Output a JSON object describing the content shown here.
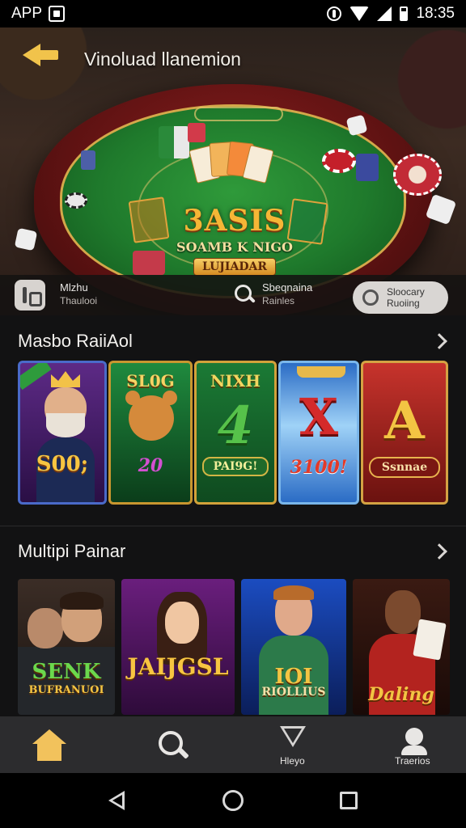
{
  "status_bar": {
    "app_label": "APP",
    "time": "18:35"
  },
  "hero": {
    "title": "Vinoluad llanemion",
    "logo_big": "3ASIS",
    "logo_small": "SOAMB K NIGO",
    "logo_plate": "LUJIADAR",
    "actions": {
      "left_title": "Mlzhu",
      "left_sub": "Thaulooi",
      "search_title": "Sbeqnaina",
      "search_sub": "Rainles",
      "pill_title": "Sloocary",
      "pill_sub": "Ruoiing"
    }
  },
  "sections": {
    "slots": {
      "title": "Masbo RaiiAol",
      "items": [
        {
          "label": "S00;"
        },
        {
          "top": "SL0G",
          "bottom": "20"
        },
        {
          "top": "NIXH",
          "big": "4",
          "plate": "PAI9G!"
        },
        {
          "big": "X",
          "bottom": "3100!"
        },
        {
          "big": "A",
          "plate": "Ssnnae"
        }
      ]
    },
    "multiplayer": {
      "title": "Multipi Painar",
      "items": [
        {
          "label": "SENK",
          "sub": "BUFRANUOI"
        },
        {
          "label": "JAIJGSL"
        },
        {
          "label": "IOI",
          "sub": "RIOLLIUS"
        },
        {
          "label": "Daling"
        }
      ]
    }
  },
  "bottom_nav": {
    "items": [
      {
        "icon": "home-icon",
        "label": ""
      },
      {
        "icon": "search-icon",
        "label": ""
      },
      {
        "icon": "promo-icon",
        "label": "Hleyo"
      },
      {
        "icon": "profile-icon",
        "label": "Traerios"
      }
    ]
  },
  "colors": {
    "accent": "#f2c25c",
    "background": "#121213",
    "nav_bg": "#2c2c2e"
  }
}
